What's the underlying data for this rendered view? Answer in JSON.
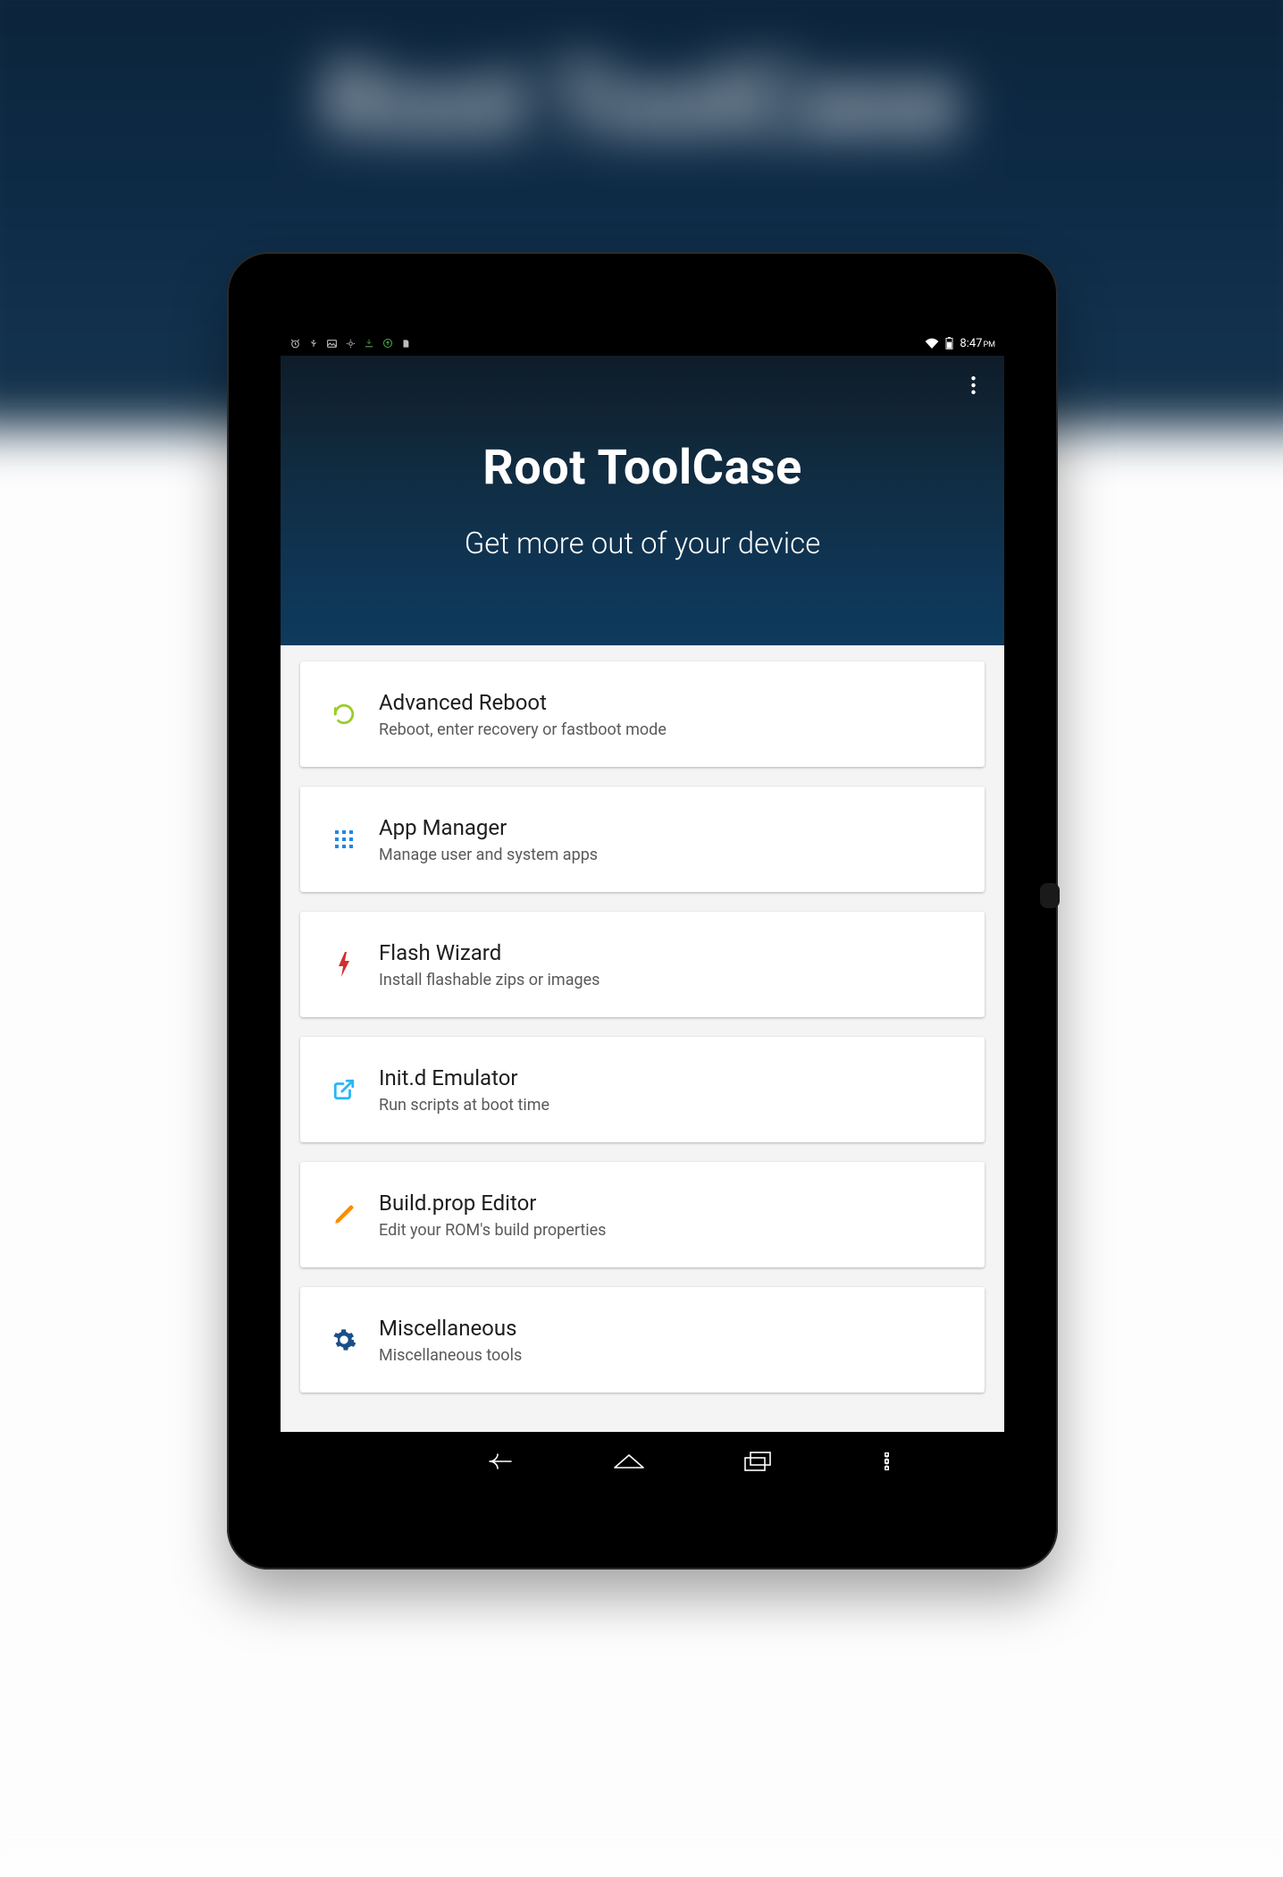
{
  "statusbar": {
    "time": "8:47",
    "ampm": "PM"
  },
  "header": {
    "title": "Root ToolCase",
    "subtitle": "Get more out of your device"
  },
  "items": [
    {
      "title": "Advanced Reboot",
      "sub": "Reboot, enter recovery or fastboot mode",
      "icon": "refresh-icon"
    },
    {
      "title": "App Manager",
      "sub": "Manage user and system apps",
      "icon": "apps-grid-icon"
    },
    {
      "title": "Flash Wizard",
      "sub": "Install flashable zips or images",
      "icon": "flash-icon"
    },
    {
      "title": "Init.d Emulator",
      "sub": "Run scripts at boot time",
      "icon": "open-external-icon"
    },
    {
      "title": "Build.prop Editor",
      "sub": "Edit your ROM's build properties",
      "icon": "pencil-icon"
    },
    {
      "title": "Miscellaneous",
      "sub": "Miscellaneous tools",
      "icon": "gear-icon"
    }
  ]
}
